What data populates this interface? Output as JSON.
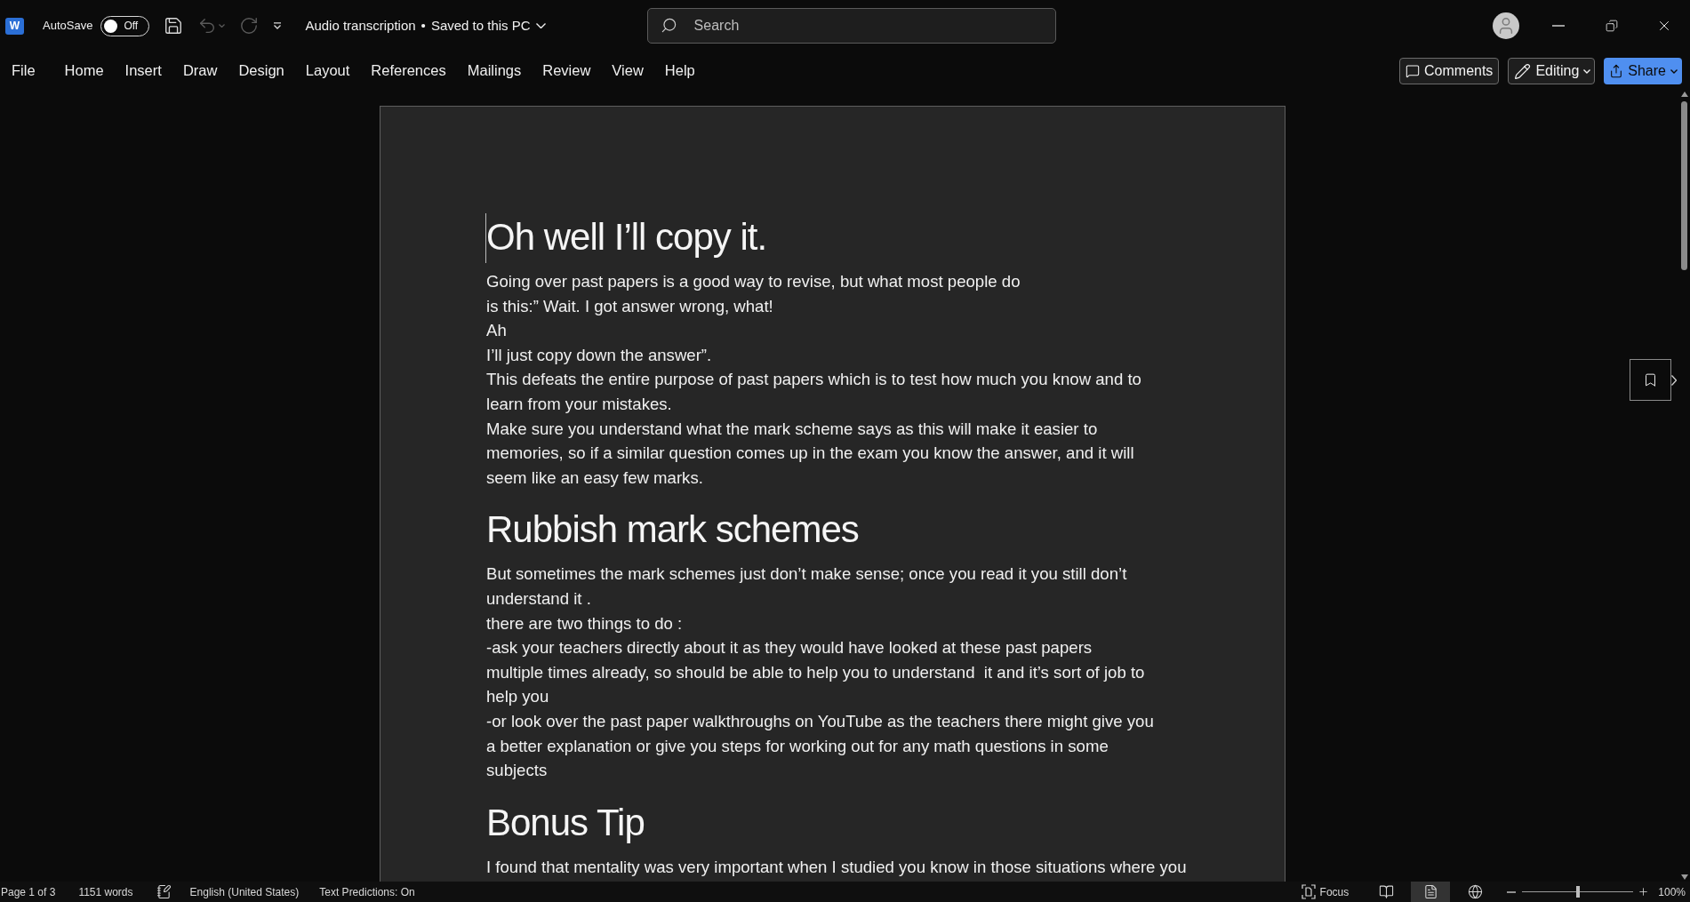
{
  "title_bar": {
    "app_logo": "W",
    "autosave": {
      "label": "AutoSave",
      "state_text": "Off",
      "on": false
    },
    "quick_access": [
      {
        "kind": "save",
        "disabled": false
      },
      {
        "kind": "undo",
        "disabled": true
      },
      {
        "kind": "redo",
        "disabled": true
      },
      {
        "kind": "customize",
        "disabled": false
      }
    ],
    "document": {
      "title": "Audio transcription",
      "separator": "•",
      "status": "Saved to this PC"
    },
    "search": {
      "placeholder": "Search"
    }
  },
  "ribbon": {
    "tabs": [
      "File",
      "Home",
      "Insert",
      "Draw",
      "Design",
      "Layout",
      "References",
      "Mailings",
      "Review",
      "View",
      "Help"
    ],
    "actions": [
      {
        "kind": "comments",
        "label": "Comments"
      },
      {
        "kind": "editing",
        "label": "Editing"
      },
      {
        "kind": "share",
        "label": "Share"
      }
    ]
  },
  "page": {
    "blocks": [
      {
        "kind": "heading",
        "text": "Oh well I’ll copy it."
      },
      {
        "kind": "paragraph",
        "lines": [
          "Going over past papers is a good way to revise, but what most people do"
        ]
      },
      {
        "kind": "paragraph",
        "lines": [
          "is this:” Wait. I got answer wrong, what!"
        ]
      },
      {
        "kind": "paragraph",
        "lines": [
          "Ah"
        ]
      },
      {
        "kind": "paragraph",
        "lines": [
          "I’ll just copy down the answer”."
        ]
      },
      {
        "kind": "paragraph",
        "lines": [
          "This defeats the entire purpose of past papers which is to test how much you know and to",
          "learn from your mistakes."
        ]
      },
      {
        "kind": "paragraph",
        "lines": [
          "Make sure you understand what the mark scheme says as this will make it easier to",
          "memories, so if a similar question comes up in the exam you know the answer, and it will",
          "seem like an easy few marks."
        ]
      },
      {
        "kind": "heading",
        "text": "Rubbish mark schemes"
      },
      {
        "kind": "paragraph",
        "lines": [
          "But sometimes the mark schemes just don’t make sense; once you read it you still don’t",
          "understand it ."
        ]
      },
      {
        "kind": "paragraph",
        "lines": [
          "there are two things to do :"
        ]
      },
      {
        "kind": "paragraph",
        "lines": [
          "-ask your teachers directly about it as they would have looked at these past papers",
          "multiple times already, so should be able to help you to understand  it and it’s sort of job to",
          "help you"
        ]
      },
      {
        "kind": "paragraph",
        "lines": [
          "-or look over the past paper walkthroughs on YouTube as the teachers there might give you",
          "a better explanation or give you steps for working out for any math questions in some",
          "subjects"
        ]
      },
      {
        "kind": "heading",
        "text": "Bonus Tip"
      },
      {
        "kind": "paragraph",
        "lines": [
          "I found that mentality was very important when I studied you know in those situations where you"
        ]
      }
    ]
  },
  "status_bar": {
    "page": "Page 1 of 3",
    "words": "1151 words",
    "language": "English (United States)",
    "text_predictions": "Text Predictions: On",
    "focus": "Focus",
    "views": [
      {
        "kind": "read",
        "selected": false
      },
      {
        "kind": "print",
        "selected": true
      },
      {
        "kind": "web",
        "selected": false
      }
    ],
    "zoom": {
      "level": 0.5,
      "reading": "100%"
    }
  }
}
